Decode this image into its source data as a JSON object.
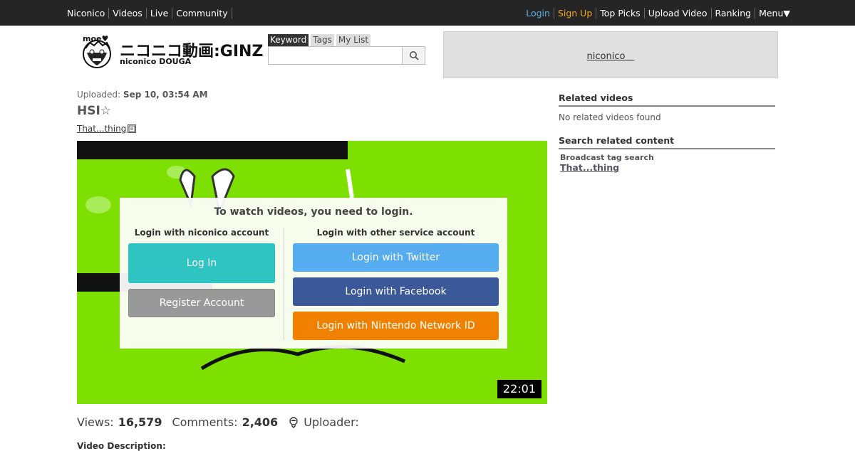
{
  "topbar": {
    "left": [
      "Niconico",
      "Videos",
      "Live",
      "Community"
    ],
    "login": "Login",
    "signup": "Sign Up",
    "right": [
      "Top Picks",
      "Upload Video",
      "Ranking",
      "Menu▼"
    ]
  },
  "logo": {
    "moe": "moe♥",
    "jp": "ニコニコ動画:GINZA",
    "en": "niconico DOUGA"
  },
  "search": {
    "tabs": [
      "Keyword",
      "Tags",
      "My List"
    ],
    "query": "",
    "icon": "search-icon"
  },
  "ad": {
    "link": "niconico　"
  },
  "video": {
    "uploaded_label": "Uploaded:",
    "uploaded_date": "Sep 10, 03:54 AM",
    "title": "HSI☆",
    "tag": "That...thing",
    "duration": "22:01"
  },
  "login_overlay": {
    "message": "To watch videos, you need to login.",
    "niconico_head": "Login with niconico account",
    "other_head": "Login with other service account",
    "login_btn": "Log In",
    "register_btn": "Register Account",
    "twitter_btn": "Login with Twitter",
    "facebook_btn": "Login with Facebook",
    "nintendo_btn": "Login with Nintendo Network ID",
    "colors": {
      "login": "#2fc3c1",
      "twitter": "#55acee",
      "facebook": "#3b5998",
      "nintendo": "#f08000"
    }
  },
  "stats": {
    "views_label": "Views:",
    "views": "16,579",
    "comments_label": "Comments:",
    "comments": "2,406",
    "uploader_label": "Uploader:",
    "uploader_icon": "user-icon"
  },
  "description_label": "Video Description:",
  "sidebar": {
    "related_title": "Related videos",
    "related_empty": "No related videos found",
    "search_title": "Search related content",
    "broadcast_label": "Broadcast tag search",
    "tag": "That...thing"
  }
}
